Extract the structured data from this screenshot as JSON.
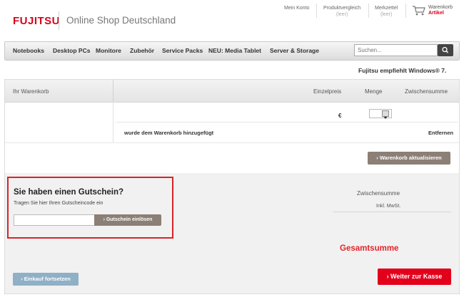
{
  "header": {
    "logo_text": "FUJITSU",
    "shop_title": "Online Shop Deutschland",
    "links": {
      "mein_konto": "Mein Konto",
      "produktvergleich": "Produktvergleich",
      "produktvergleich_status": "(leer)",
      "merkzettel": "Merkzettel",
      "merkzettel_status": "(leer)",
      "warenkorb": "Warenkorb",
      "warenkorb_count": "Artikel"
    },
    "brand_color": "#d8001a"
  },
  "nav": {
    "items": [
      "Notebooks",
      "Desktop PCs",
      "Monitore",
      "Zubehör",
      "Service Packs",
      "NEU: Media Tablet",
      "Server & Storage"
    ],
    "search_placeholder": "Suchen..."
  },
  "recommendation": "Fujitsu empfiehlt Windows® 7.",
  "cart": {
    "title": "Ihr Warenkorb",
    "columns": [
      "Einzelpreis",
      "Menge",
      "Zwischensumme"
    ],
    "currency_symbol": "€",
    "added_message": "wurde dem Warenkorb hinzugefügt",
    "remove_label": "Entfernen",
    "update_button": "› Warenkorb aktualisieren"
  },
  "voucher": {
    "title": "Sie haben einen Gutschein?",
    "subtitle": "Tragen Sie hier Ihren Gutscheincode ein",
    "input_value": "",
    "redeem_button": "› Gutschein einlösen",
    "highlight_color": "#d8232a"
  },
  "summary": {
    "subtotal_label": "Zwischensumme",
    "tax_label": "Inkl. MwSt.",
    "total_label": "Gesamtsumme",
    "total_color": "#e3242b"
  },
  "actions": {
    "continue_shopping": "› Einkauf fortsetzen",
    "checkout": "› Weiter zur Kasse",
    "checkout_color": "#e3001b"
  }
}
